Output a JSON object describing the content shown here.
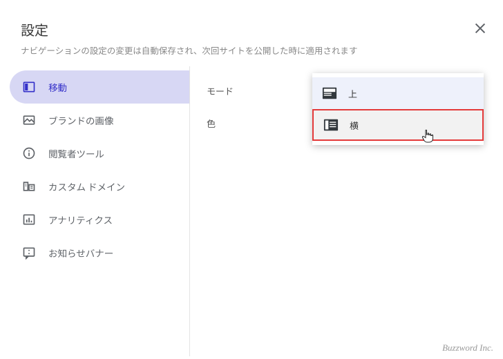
{
  "header": {
    "title": "設定",
    "subtitle": "ナビゲーションの設定の変更は自動保存され、次回サイトを公開した時に適用されます"
  },
  "sidebar": {
    "items": [
      {
        "label": "移動",
        "active": true,
        "icon": "nav-icon"
      },
      {
        "label": "ブランドの画像",
        "active": false,
        "icon": "image-icon"
      },
      {
        "label": "閲覧者ツール",
        "active": false,
        "icon": "info-icon"
      },
      {
        "label": "カスタム ドメイン",
        "active": false,
        "icon": "domain-icon"
      },
      {
        "label": "アナリティクス",
        "active": false,
        "icon": "analytics-icon"
      },
      {
        "label": "お知らせバナー",
        "active": false,
        "icon": "announce-icon"
      }
    ]
  },
  "content": {
    "rows": [
      {
        "label": "モード"
      },
      {
        "label": "色"
      }
    ]
  },
  "dropdown": {
    "items": [
      {
        "label": "上",
        "selected": true,
        "highlight": false
      },
      {
        "label": "横",
        "selected": false,
        "highlight": true
      }
    ]
  },
  "footer": {
    "text": "Buzzword Inc."
  }
}
